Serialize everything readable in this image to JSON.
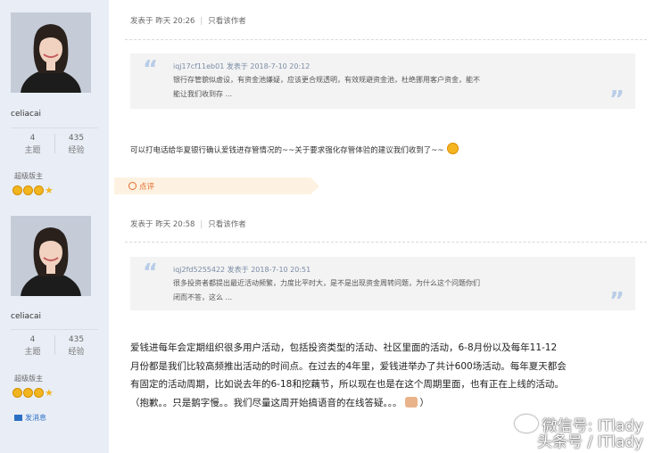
{
  "posts": [
    {
      "user": {
        "name": "celiacai",
        "topics_label": "主题",
        "topics": "4",
        "exp_label": "经验",
        "exp": "435",
        "rank": "超级版主"
      },
      "meta": {
        "posted": "发表于 昨天 20:26",
        "only_author": "只看该作者"
      },
      "quote": {
        "header": "iqj17cf11eb01 发表于 2018-7-10 20:12",
        "line1": "银行存管貌似虚设，有资金池嫌疑，应该更合规透明，有效规避资金池，杜绝挪用客户资金，能不",
        "line2": "能让我们收到存 ..."
      },
      "body": "可以打电话给华夏银行确认爱钱进存管情况的~~关于要求强化存管体验的建议我们收到了~~",
      "comment_label": "点评"
    },
    {
      "user": {
        "name": "celiacai",
        "topics_label": "主题",
        "topics": "4",
        "exp_label": "经验",
        "exp": "435",
        "rank": "超级版主",
        "pm": "发消息"
      },
      "meta": {
        "posted": "发表于 昨天 20:58",
        "only_author": "只看该作者"
      },
      "quote": {
        "header": "iqj2fd5255422 发表于 2018-7-10 20:51",
        "line1": "很多投资者都提出最近活动频繁，力度比平时大，是不是出现资金周转问题，为什么这个问题你们",
        "line2": "闭而不答，这么 ..."
      },
      "body_lines": [
        "爱钱进每年会定期组织很多用户活动，包括投资类型的活动、社区里面的活动，6-8月份以及每年11-12",
        "月份都是我们比较高频推出活动的时间点。在过去的4年里，爱钱进举办了共计600场活动。每年夏天都会",
        "有固定的活动周期，比如说去年的6-18和挖藕节，所以现在也是在这个周期里面，也有正在上线的活动。",
        "（抱歉。。只是鹅字慢。。我们尽量这周开始搞语音的在线答疑。。。",
        "）"
      ]
    }
  ],
  "watermark": {
    "line1": "微信号: ITlady",
    "line2": "头条号 / ITlady"
  },
  "colors": {
    "sidebar": "#e9eef6",
    "comment": "#e36b2c",
    "quote_bg": "#f3f3f3",
    "quote_mark": "#b8cde8"
  }
}
